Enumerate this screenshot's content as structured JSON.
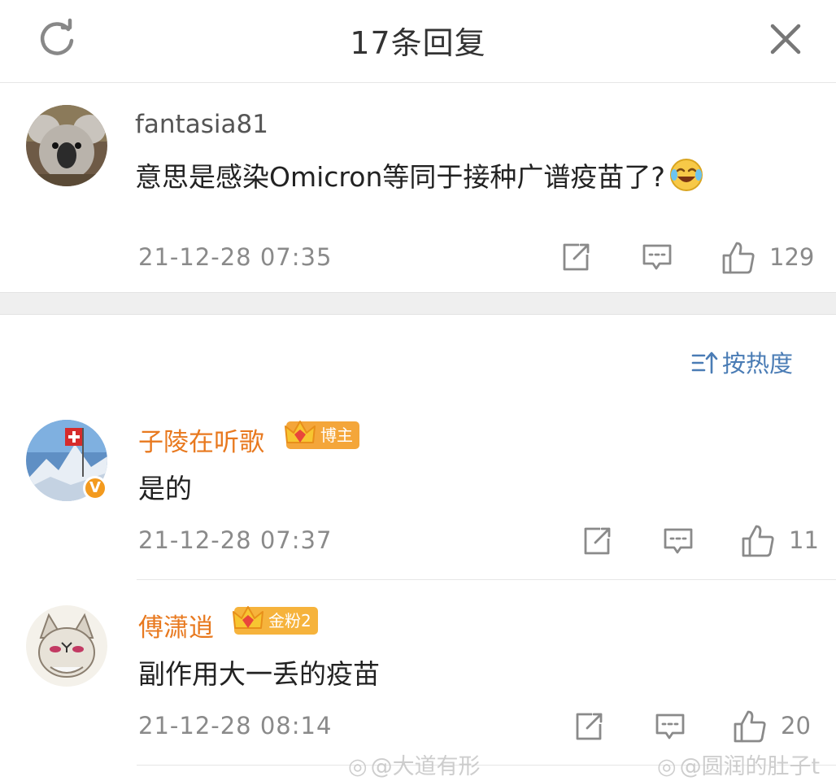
{
  "header": {
    "title": "17条回复"
  },
  "root": {
    "username": "fantasia81",
    "text": "意思是感染Omicron等同于接种广谱疫苗了?",
    "time": "21-12-28 07:35",
    "likes": "129"
  },
  "sort": {
    "label": "按热度"
  },
  "replies": [
    {
      "username": "子陵在听歌",
      "badge": "博主",
      "text": "是的",
      "time": "21-12-28 07:37",
      "likes": "11"
    },
    {
      "username": "傅潇逍",
      "badge": "金粉2",
      "text": "副作用大一丢的疫苗",
      "time": "21-12-28 08:14",
      "likes": "20"
    }
  ],
  "watermarks": [
    "@大道有形",
    "@圆润的肚子t"
  ],
  "colors": {
    "username_highlight": "#e8791f",
    "sort_link": "#4a7cb5",
    "badge": "#f4a63a"
  }
}
